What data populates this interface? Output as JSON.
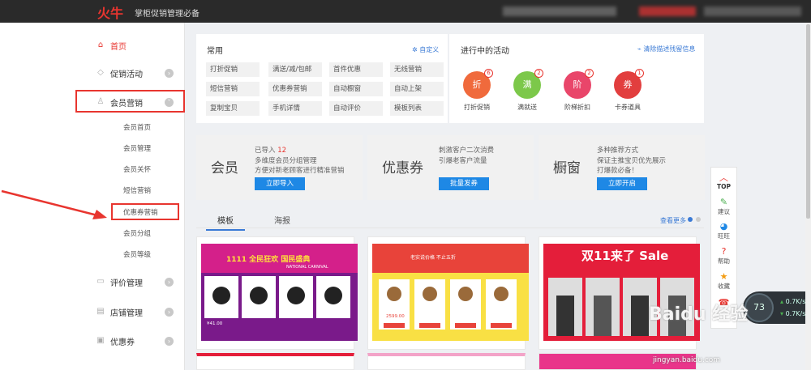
{
  "header": {
    "logo": "火牛",
    "slogan": "掌柜促销管理必备"
  },
  "sidebar": {
    "items": [
      {
        "label": "首页",
        "icon": "home-icon"
      },
      {
        "label": "促销活动",
        "icon": "tag-icon"
      },
      {
        "label": "会员营销",
        "icon": "user-icon"
      },
      {
        "label": "评价管理",
        "icon": "comment-icon"
      },
      {
        "label": "店铺管理",
        "icon": "shop-icon"
      },
      {
        "label": "优惠券",
        "icon": "coupon-icon"
      }
    ],
    "subitems": [
      "会员首页",
      "会员管理",
      "会员关怀",
      "短信营销",
      "优惠券营销",
      "会员分组",
      "会员等级"
    ]
  },
  "common": {
    "title": "常用",
    "customize": "自定义",
    "chips": [
      "打折促销",
      "满送/减/包邮",
      "首件优惠",
      "无线营销",
      "短信营销",
      "优惠券营销",
      "自动橱窗",
      "自动上架",
      "复制宝贝",
      "手机详情",
      "自动评价",
      "模板列表"
    ]
  },
  "activities": {
    "title": "进行中的活动",
    "clear": "清除描述残留信息",
    "items": [
      {
        "label": "打折促销",
        "glyph": "折",
        "count": "6",
        "color": "#f06a3c"
      },
      {
        "label": "满就送",
        "glyph": "满",
        "count": "2",
        "color": "#7cc84a"
      },
      {
        "label": "阶梯折扣",
        "glyph": "阶",
        "count": "2",
        "color": "#e9466a"
      },
      {
        "label": "卡券道具",
        "glyph": "券",
        "count": "1",
        "color": "#e23e3e"
      }
    ]
  },
  "cards": [
    {
      "big": "会员",
      "l1a": "已导入 ",
      "l1b": "12",
      "l2": "多维度会员分组管理",
      "l3": "方便对新老顾客进行精准营销",
      "btn": "立即导入"
    },
    {
      "big": "优惠券",
      "l1a": "刺激客户二次消费",
      "l1b": "",
      "l2": "引爆老客户流量",
      "l3": "",
      "btn": "批量发券"
    },
    {
      "big": "橱窗",
      "l1a": "多种推荐方式",
      "l1b": "",
      "l2": "保证主推宝贝优先展示",
      "l3": "打爆款必备！",
      "btn": "立即开启"
    }
  ],
  "tabs": {
    "active": "模板",
    "other": "海报",
    "more": "查看更多"
  },
  "templates": [
    {
      "banner": "1111 全民狂欢 国民盛典",
      "sub": "NATIONAL CARNIVAL",
      "price": "¥41.00"
    },
    {
      "banner": "老实说价格 不止五折",
      "sub": "",
      "price": "2599.00"
    },
    {
      "banner": "双11来了 Sale",
      "sub": "",
      "price": ""
    }
  ],
  "righttool": [
    {
      "label": "TOP",
      "icon": "chevron-up-icon"
    },
    {
      "label": "建议",
      "icon": "pencil-icon"
    },
    {
      "label": "旺旺",
      "icon": "chat-icon"
    },
    {
      "label": "帮助",
      "icon": "help-icon"
    },
    {
      "label": "收藏",
      "icon": "star-icon"
    },
    {
      "label": "",
      "icon": "phone-icon"
    }
  ],
  "speed": {
    "pct": "73",
    "up": "0.7K/s",
    "down": "0.7K/s"
  },
  "watermark": {
    "brand": "Baidu 经验",
    "url": "jingyan.baidu.com"
  }
}
